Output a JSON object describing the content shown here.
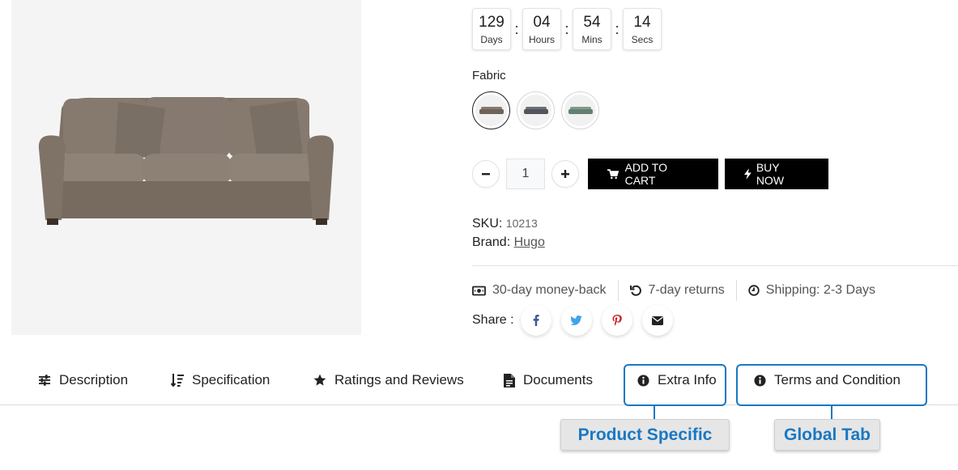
{
  "countdown": [
    {
      "value": "129",
      "label": "Days"
    },
    {
      "value": "04",
      "label": "Hours"
    },
    {
      "value": "54",
      "label": "Mins"
    },
    {
      "value": "14",
      "label": "Secs"
    }
  ],
  "countdown_separator": ":",
  "fabric": {
    "label": "Fabric",
    "swatches": [
      {
        "name": "brown",
        "color": "#8a7a6e"
      },
      {
        "name": "gray",
        "color": "#6c6f76"
      },
      {
        "name": "green",
        "color": "#7f9c8b"
      }
    ]
  },
  "quantity": {
    "value": "1",
    "minus_icon": "minus-icon",
    "plus_icon": "plus-icon"
  },
  "buttons": {
    "add_to_cart": "ADD TO CART",
    "buy_now": "BUY NOW"
  },
  "sku": {
    "label": "SKU:",
    "value": "10213"
  },
  "brand": {
    "label": "Brand:",
    "value": "Hugo"
  },
  "features": [
    {
      "icon": "money-icon",
      "text": "30-day money-back"
    },
    {
      "icon": "return-icon",
      "text": "7-day returns"
    },
    {
      "icon": "clock-icon",
      "text": "Shipping: 2-3 Days"
    }
  ],
  "share": {
    "label": "Share :",
    "networks": [
      {
        "name": "facebook",
        "color": "#3b5998"
      },
      {
        "name": "twitter",
        "color": "#1da1f2"
      },
      {
        "name": "pinterest",
        "color": "#cb2027"
      },
      {
        "name": "email",
        "color": "#222222"
      }
    ]
  },
  "tabs": [
    {
      "label": "Description",
      "icon": "sliders-icon"
    },
    {
      "label": "Specification",
      "icon": "sort-icon"
    },
    {
      "label": "Ratings and Reviews",
      "icon": "star-icon"
    },
    {
      "label": "Documents",
      "icon": "document-icon"
    },
    {
      "label": "Extra Info",
      "icon": "info-icon"
    },
    {
      "label": "Terms and Condition",
      "icon": "info-icon"
    }
  ],
  "callouts": {
    "product_specific": "Product Specific",
    "global_tab": "Global Tab"
  },
  "colors": {
    "accent": "#1a78c2",
    "button": "#000000"
  }
}
